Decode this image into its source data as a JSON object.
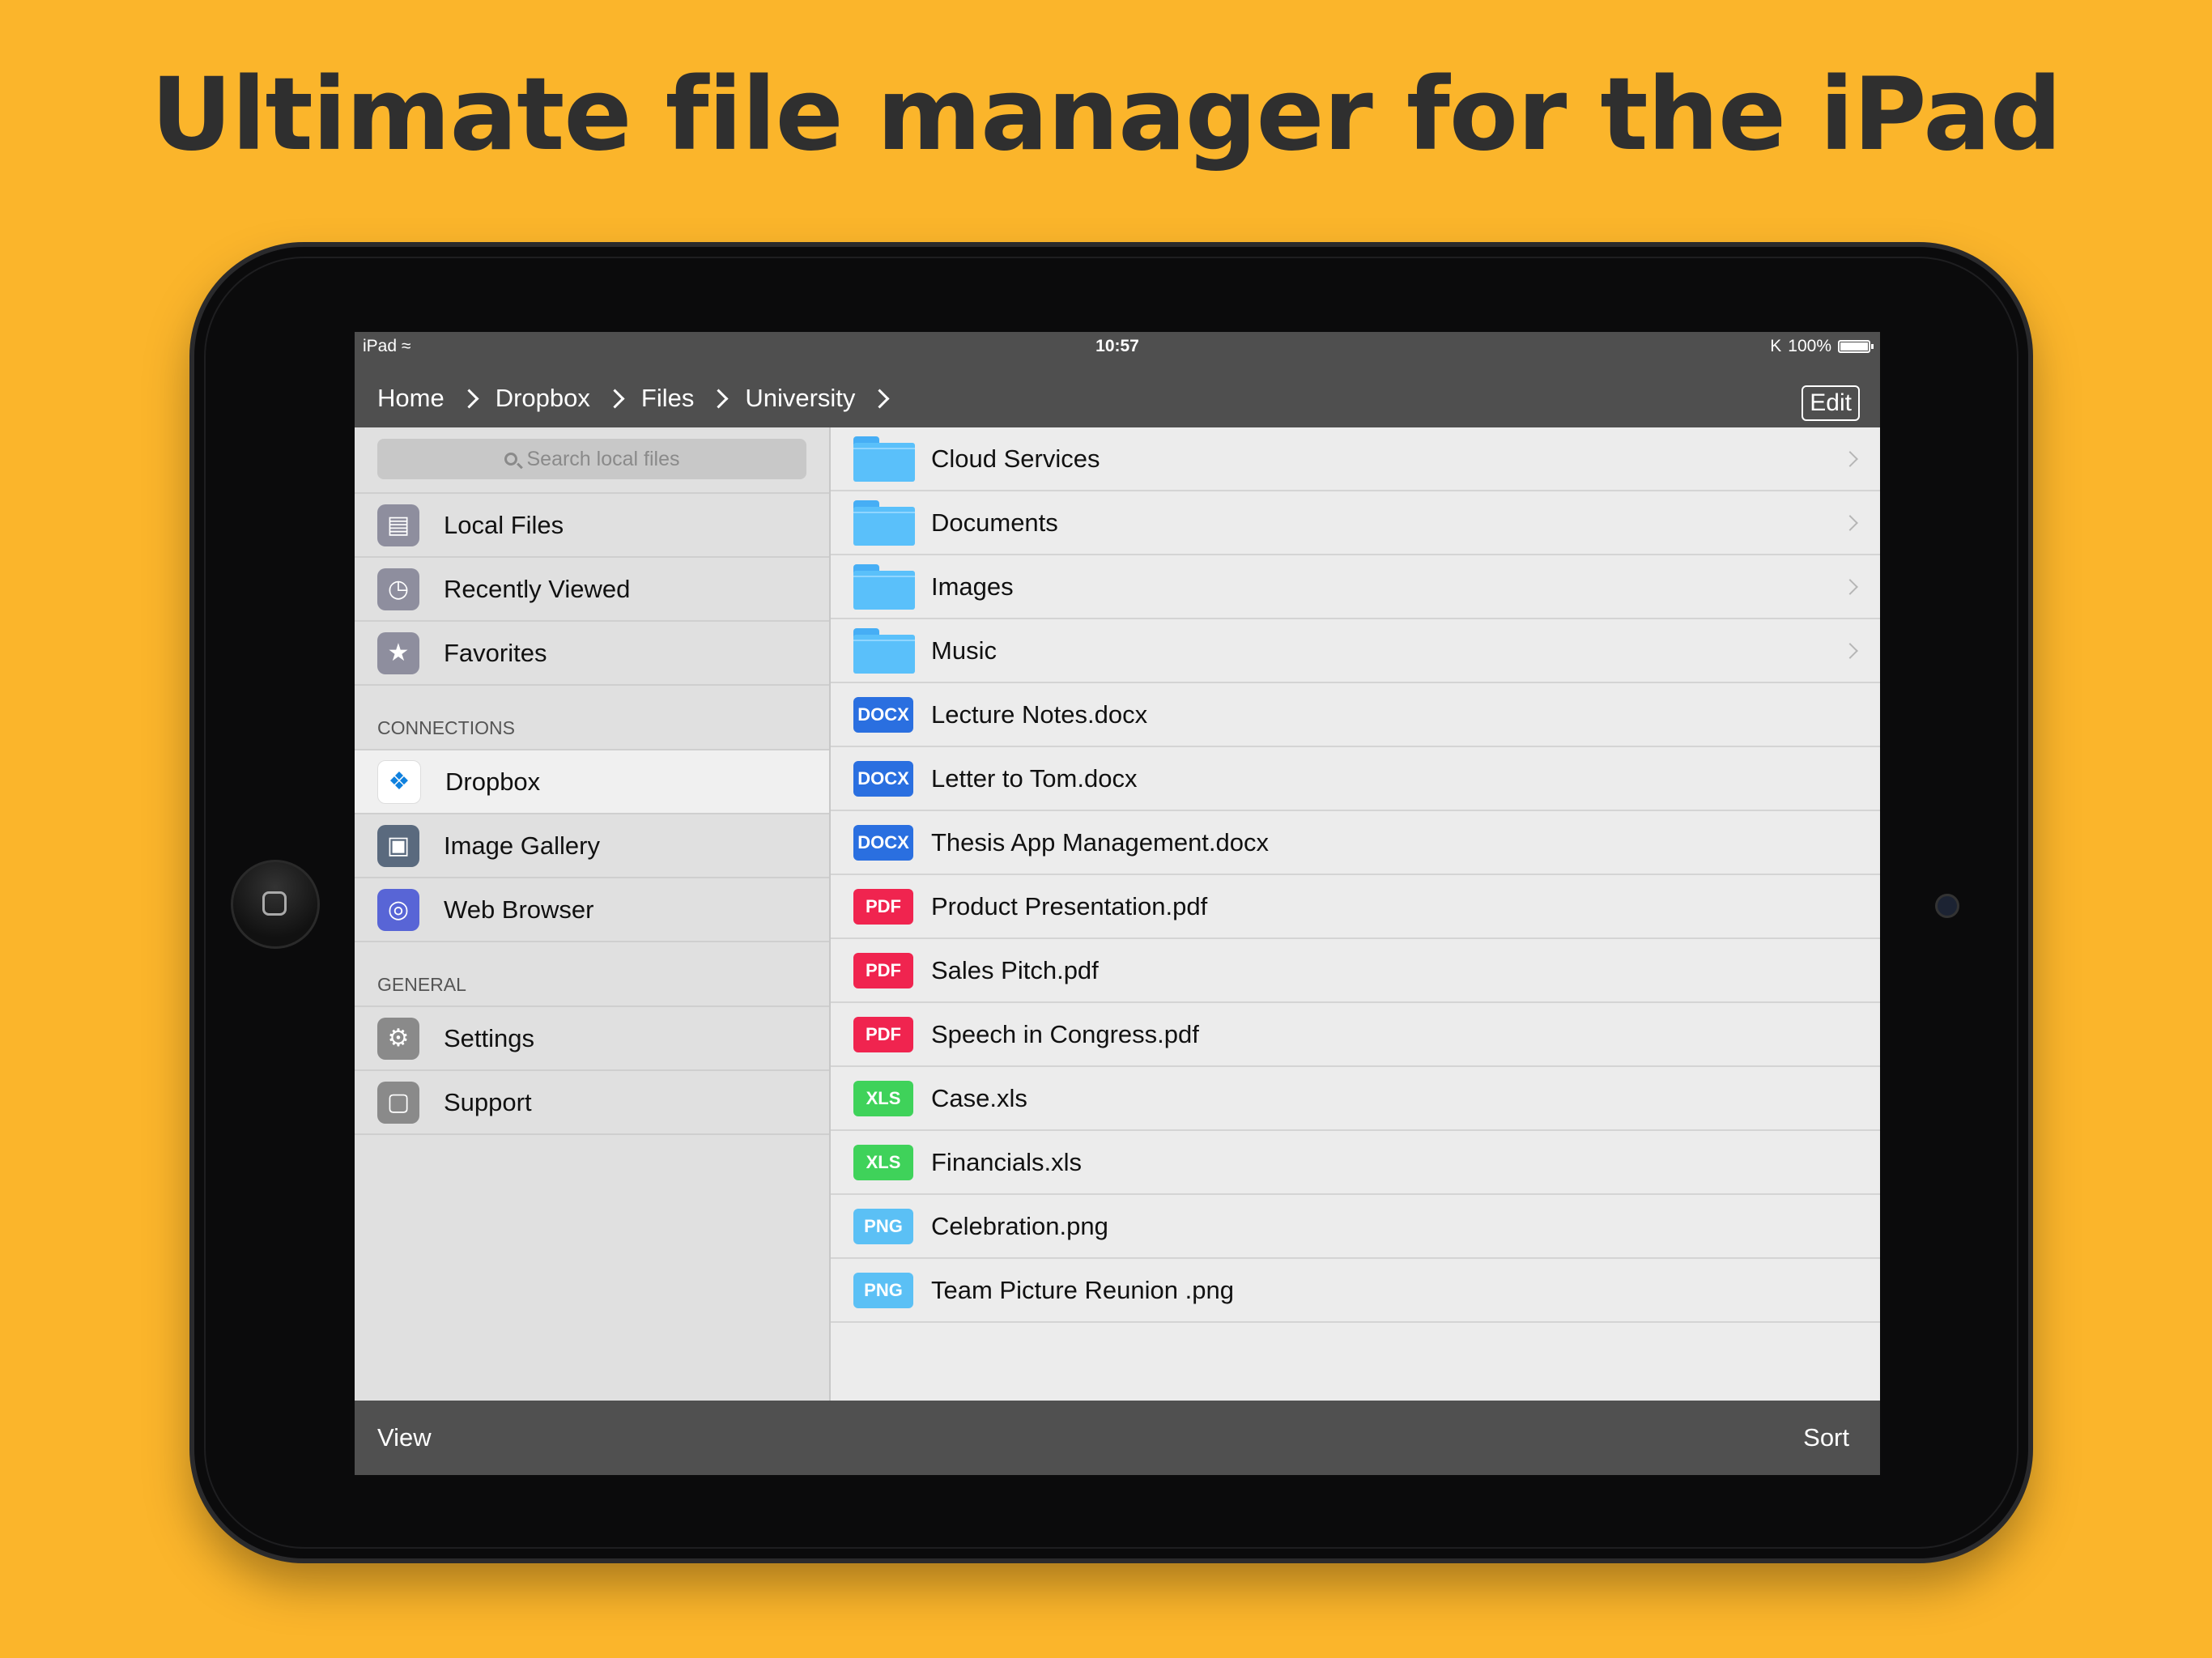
{
  "headline": "Ultimate file manager for the iPad",
  "status": {
    "carrier": "iPad",
    "time": "10:57",
    "battery": "100%"
  },
  "breadcrumb": [
    "Home",
    "Dropbox",
    "Files",
    "University"
  ],
  "edit_label": "Edit",
  "search": {
    "placeholder": "Search local files"
  },
  "sidebar": {
    "top_items": [
      {
        "label": "Local Files",
        "icon": "folder-icon",
        "color": "#8e8e9e"
      },
      {
        "label": "Recently Viewed",
        "icon": "clock-icon",
        "color": "#8e8e9e"
      },
      {
        "label": "Favorites",
        "icon": "star-icon",
        "color": "#8e8e9e"
      }
    ],
    "connections_header": "CONNECTIONS",
    "connections": [
      {
        "label": "Dropbox",
        "icon": "dropbox-icon",
        "color": "#ffffff",
        "selected": true
      },
      {
        "label": "Image Gallery",
        "icon": "image-icon",
        "color": "#5a6a7e"
      },
      {
        "label": "Web Browser",
        "icon": "globe-icon",
        "color": "#5865d6"
      }
    ],
    "general_header": "GENERAL",
    "general": [
      {
        "label": "Settings",
        "icon": "gear-icon",
        "color": "#8a8a8a"
      },
      {
        "label": "Support",
        "icon": "chat-bubble-icon",
        "color": "#8a8a8a"
      }
    ]
  },
  "files": [
    {
      "name": "Cloud Services",
      "kind": "folder"
    },
    {
      "name": "Documents",
      "kind": "folder"
    },
    {
      "name": "Images",
      "kind": "folder"
    },
    {
      "name": "Music",
      "kind": "folder"
    },
    {
      "name": "Lecture Notes.docx",
      "kind": "DOCX",
      "color": "#2a6fe0"
    },
    {
      "name": "Letter to Tom.docx",
      "kind": "DOCX",
      "color": "#2a6fe0"
    },
    {
      "name": "Thesis App Management.docx",
      "kind": "DOCX",
      "color": "#2a6fe0"
    },
    {
      "name": "Product Presentation.pdf",
      "kind": "PDF",
      "color": "#f0244f"
    },
    {
      "name": "Sales Pitch.pdf",
      "kind": "PDF",
      "color": "#f0244f"
    },
    {
      "name": "Speech in Congress.pdf",
      "kind": "PDF",
      "color": "#f0244f"
    },
    {
      "name": "Case.xls",
      "kind": "XLS",
      "color": "#3fd25a"
    },
    {
      "name": "Financials.xls",
      "kind": "XLS",
      "color": "#3fd25a"
    },
    {
      "name": "Celebration.png",
      "kind": "PNG",
      "color": "#5bc0f5"
    },
    {
      "name": "Team Picture Reunion .png",
      "kind": "PNG",
      "color": "#5bc0f5"
    }
  ],
  "toolbar": {
    "view_label": "View",
    "sort_label": "Sort"
  }
}
